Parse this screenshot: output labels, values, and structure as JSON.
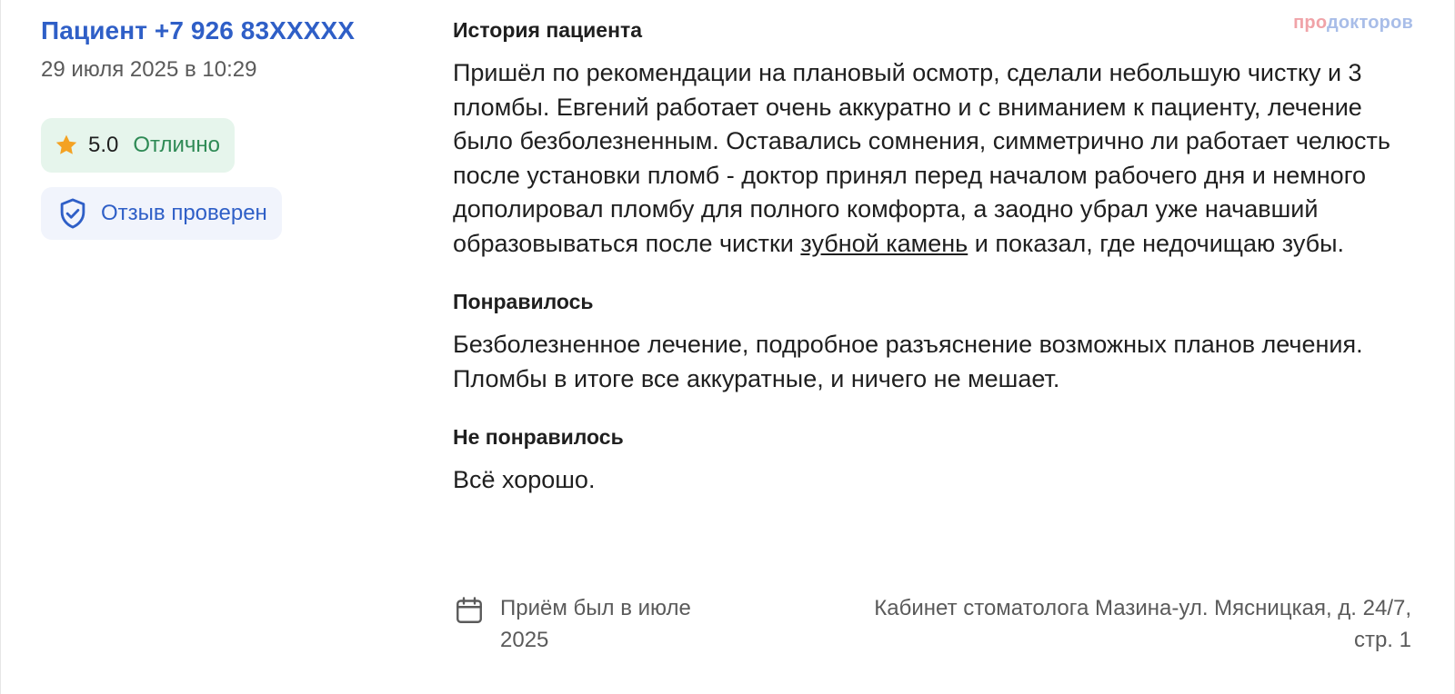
{
  "review": {
    "author": "Пациент +7 926 83XXXXX",
    "date": "29 июля 2025 в 10:29",
    "rating": {
      "value": "5.0",
      "label": "Отлично",
      "icon": "star-icon",
      "star_color": "#f4a223"
    },
    "verified": {
      "label": "Отзыв проверен",
      "icon": "shield-check-icon"
    }
  },
  "brand": {
    "part1": "про",
    "part2": "докторов"
  },
  "sections": {
    "history": {
      "title": "История пациента",
      "text_before_link": "Пришёл по рекомендации на плановый осмотр, сделали небольшую чистку и 3 пломбы. Евгений работает очень аккуратно и с вниманием к пациенту, лечение было безболезненным. Оставались сомнения, симметрично ли работает челюсть после установки пломб - доктор принял перед началом рабочего дня и немного дополировал пломбу для полного комфорта, а заодно убрал уже начавший образовываться после чистки ",
      "link": "зубной камень",
      "text_after_link": " и показал, где недочищаю зубы."
    },
    "liked": {
      "title": "Понравилось",
      "text": "Безболезненное лечение, подробное разъяснение возможных планов лечения. Пломбы в итоге все аккуратные, и ничего не мешает."
    },
    "disliked": {
      "title": "Не понравилось",
      "text": "Всё хорошо."
    }
  },
  "footer": {
    "visit": "Приём был в июле 2025",
    "visit_icon": "calendar-icon",
    "clinic": "Кабинет стоматолога Мазина-ул. Мясницкая, д. 24/7, стр. 1"
  },
  "colors": {
    "accent": "#2f5fc7",
    "rating_bg": "#e6f5ec",
    "rating_text": "#2e8a55",
    "verified_bg": "#f1f4fc"
  }
}
